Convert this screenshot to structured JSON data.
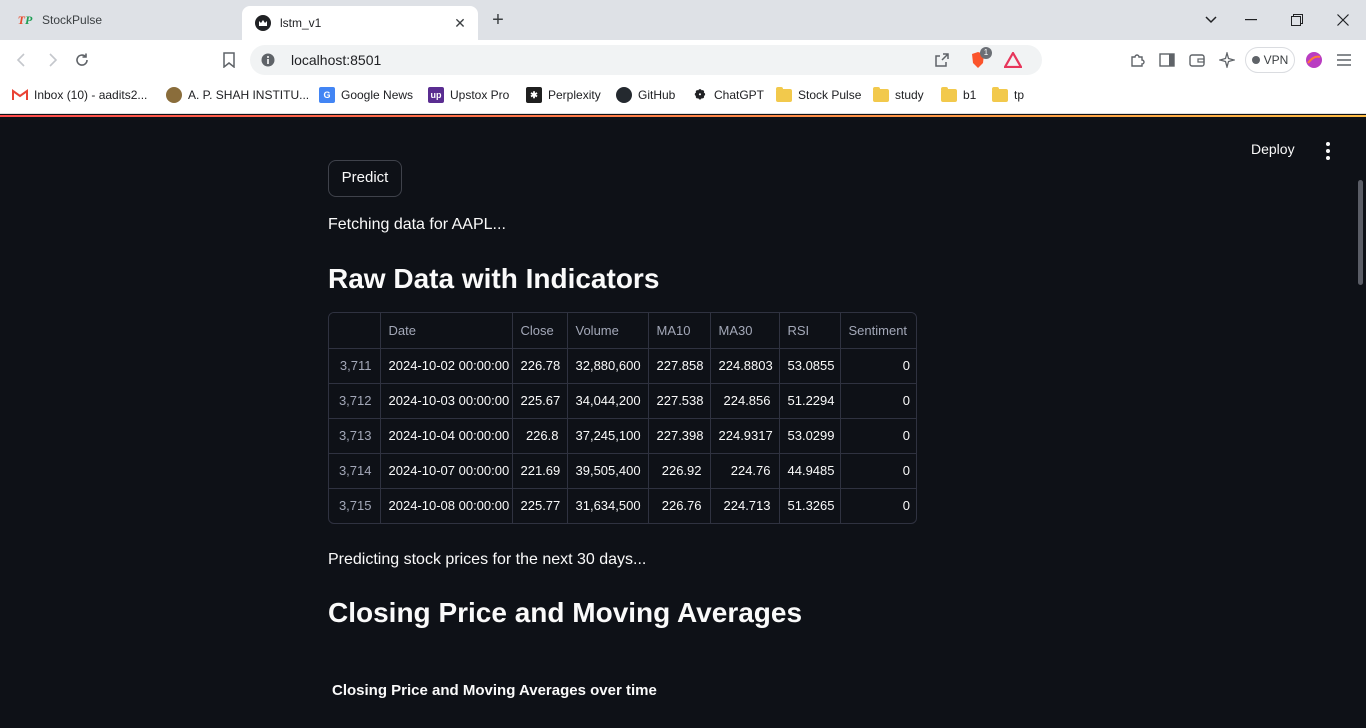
{
  "browser": {
    "tabs": [
      {
        "title": "StockPulse",
        "active": false
      },
      {
        "title": "lstm_v1",
        "active": true
      }
    ],
    "url": "localhost:8501",
    "vpn_label": "VPN",
    "brave_badge": "1",
    "bookmarks": [
      {
        "label": "Inbox (10) - aadits2...",
        "icon": "gmail-icon"
      },
      {
        "label": "A. P. SHAH INSTITU...",
        "icon": "institute-icon"
      },
      {
        "label": "Google News",
        "icon": "google-news-icon"
      },
      {
        "label": "Upstox Pro",
        "icon": "upstox-icon"
      },
      {
        "label": "Perplexity",
        "icon": "perplexity-icon"
      },
      {
        "label": "GitHub",
        "icon": "github-icon"
      },
      {
        "label": "ChatGPT",
        "icon": "chatgpt-icon"
      },
      {
        "label": "Stock Pulse",
        "icon": "folder-icon"
      },
      {
        "label": "study",
        "icon": "folder-icon"
      },
      {
        "label": "b1",
        "icon": "folder-icon"
      },
      {
        "label": "tp",
        "icon": "folder-icon"
      }
    ]
  },
  "app": {
    "deploy_label": "Deploy",
    "predict_button": "Predict",
    "fetching_text": "Fetching data for AAPL...",
    "raw_heading": "Raw Data with Indicators",
    "table": {
      "columns": [
        "",
        "Date",
        "Close",
        "Volume",
        "MA10",
        "MA30",
        "RSI",
        "Sentiment"
      ],
      "rows": [
        [
          "3,711",
          "2024-10-02 00:00:00",
          "226.78",
          "32,880,600",
          "227.858",
          "224.8803",
          "53.0855",
          "0"
        ],
        [
          "3,712",
          "2024-10-03 00:00:00",
          "225.67",
          "34,044,200",
          "227.538",
          "224.856",
          "51.2294",
          "0"
        ],
        [
          "3,713",
          "2024-10-04 00:00:00",
          "226.8",
          "37,245,100",
          "227.398",
          "224.9317",
          "53.0299",
          "0"
        ],
        [
          "3,714",
          "2024-10-07 00:00:00",
          "221.69",
          "39,505,400",
          "226.92",
          "224.76",
          "44.9485",
          "0"
        ],
        [
          "3,715",
          "2024-10-08 00:00:00",
          "225.77",
          "31,634,500",
          "226.76",
          "224.713",
          "51.3265",
          "0"
        ]
      ]
    },
    "predicting_text": "Predicting stock prices for the next 30 days...",
    "closing_heading": "Closing Price and Moving Averages",
    "chart_title": "Closing Price and Moving Averages over time"
  },
  "colors": {
    "app_background": "#0e1117",
    "text": "#fafafa",
    "muted_text": "#a3a8b8",
    "accent_gradient_start": "#ff4b4b",
    "accent_gradient_end": "#ffbd45"
  }
}
